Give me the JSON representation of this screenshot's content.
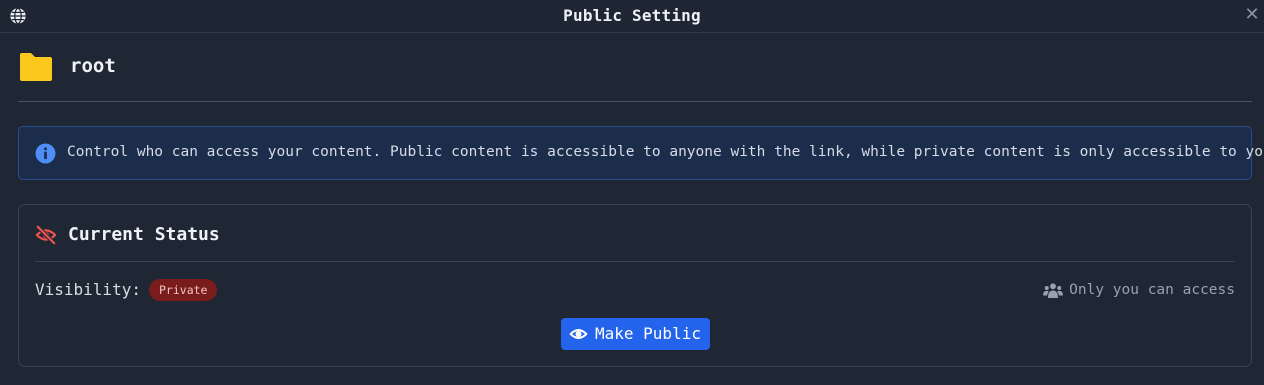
{
  "dialog": {
    "title": "Public Setting",
    "close_glyph": "✕",
    "header_icon": "globe-icon"
  },
  "folder": {
    "name": "root",
    "icon": "folder-icon",
    "icon_color": "#fcc81e"
  },
  "info_banner": {
    "icon": "info-icon",
    "text": "Control who can access your content. Public content is accessible to anyone with the link, while private content is only accessible to you."
  },
  "status_card": {
    "title": "Current Status",
    "title_icon": "eye-slash-icon",
    "visibility_label": "Visibility:",
    "visibility_value": "Private",
    "access_icon": "users-icon",
    "access_text": "Only you can access",
    "action_button": {
      "label": "Make Public",
      "icon": "eye-icon"
    }
  },
  "colors": {
    "background": "#1f2734",
    "accent": "#2463eb",
    "private_badge": "#7a1c1c",
    "status_icon": "#ef5350",
    "info_icon": "#4f8ef7"
  }
}
